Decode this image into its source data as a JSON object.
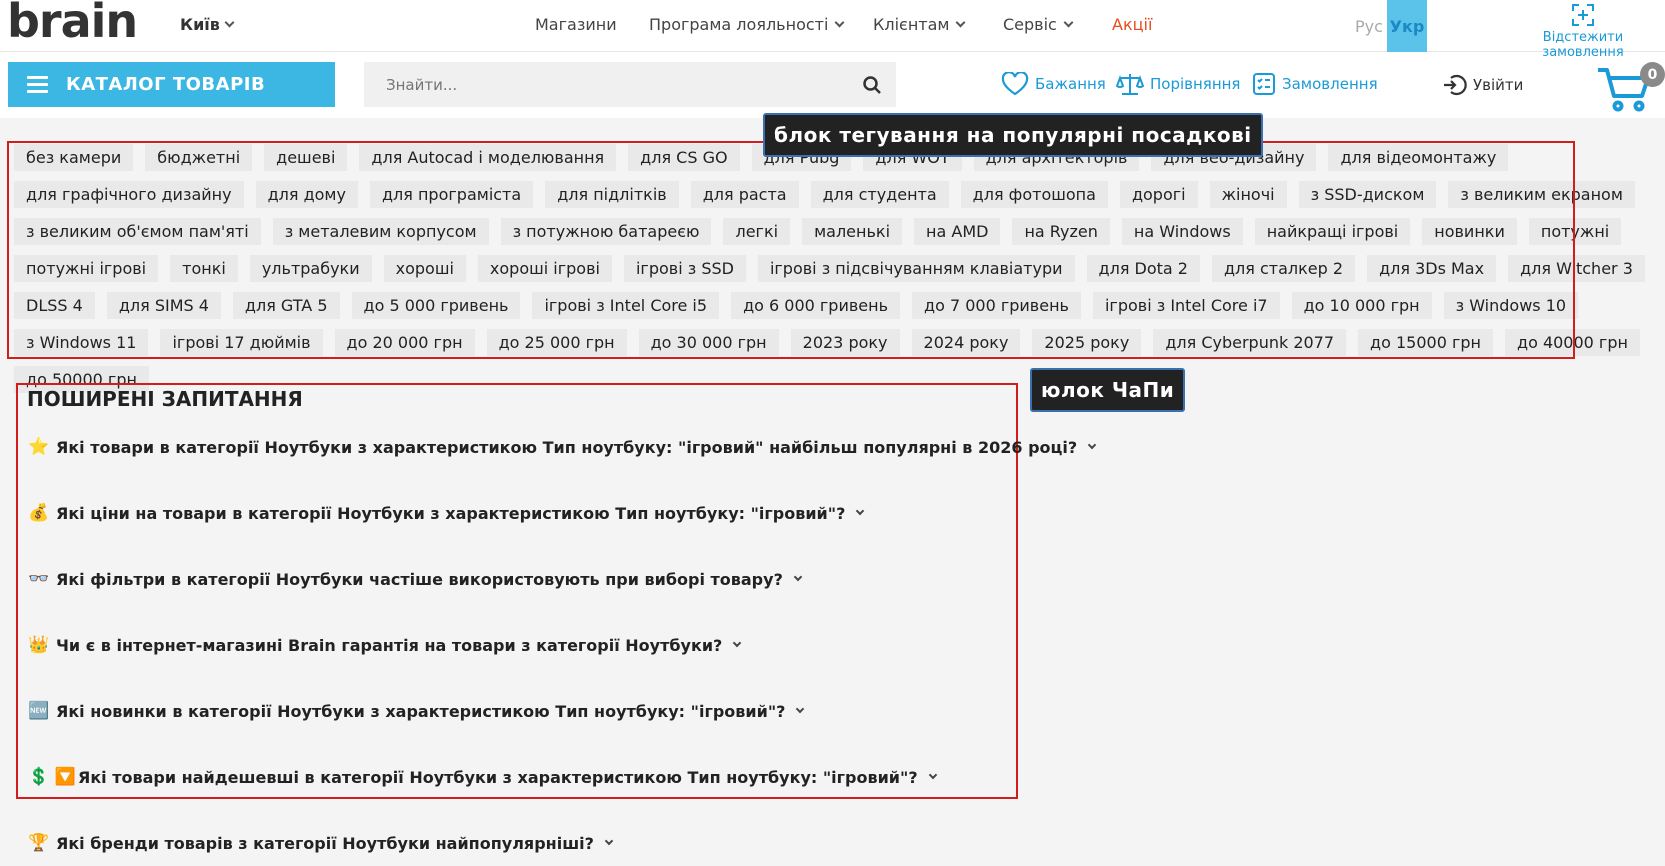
{
  "header": {
    "logo": "brain",
    "city": "Київ",
    "nav": [
      {
        "label": "Магазини",
        "dropdown": false
      },
      {
        "label": "Програма лояльності",
        "dropdown": true
      },
      {
        "label": "Клієнтам",
        "dropdown": true
      },
      {
        "label": "Сервіс",
        "dropdown": true
      },
      {
        "label": "Акції",
        "dropdown": false
      }
    ],
    "lang": {
      "ru": "Рус",
      "uk": "Укр",
      "active": "uk"
    },
    "track_order": "Відстежити замовлення"
  },
  "toolbar": {
    "catalog_label": "КАТАЛОГ ТОВАРІВ",
    "search_placeholder": "Знайти...",
    "wishlist": "Бажання",
    "compare": "Порівняння",
    "orders": "Замовлення",
    "login": "Увійти",
    "cart_count": "0"
  },
  "tags": [
    "без камери",
    "бюджетні",
    "дешеві",
    "для Autocad і моделювання",
    "для CS GO",
    "для Pubg",
    "для WOT",
    "для архітекторів",
    "для веб-дизайну",
    "для відеомонтажу",
    "для графічного дизайну",
    "для дому",
    "для програміста",
    "для підлітків",
    "для раста",
    "для студента",
    "для фотошопа",
    "дорогі",
    "жіночі",
    "з SSD-диском",
    "з великим екраном",
    "з великим об'ємом пам'яті",
    "з металевим корпусом",
    "з потужною батареєю",
    "легкі",
    "маленькі",
    "на AMD",
    "на Ryzen",
    "на Windows",
    "найкращі ігрові",
    "новинки",
    "потужні",
    "потужні ігрові",
    "тонкі",
    "ультрабуки",
    "хороші",
    "хороші ігрові",
    "ігрові з SSD",
    "ігрові з підсвічуванням клавіатури",
    "для Dota 2",
    "для сталкер 2",
    "для 3Ds Max",
    "для Witcher 3",
    "DLSS 4",
    "для SIMS 4",
    "для GTA 5",
    "до 5 000 гривень",
    "ігрові з Intel Core i5",
    "до 6 000 гривень",
    "до 7 000 гривень",
    "ігрові з Intel Core i7",
    "до 10 000 грн",
    "з Windows 10",
    "з Windows 11",
    "ігрові 17 дюймів",
    "до 20 000 грн",
    "до 25 000 грн",
    "до 30 000 грн",
    "2023 року",
    "2024 року",
    "2025 року",
    "для Cyberpunk 2077",
    "до 15000 грн",
    "до 40000 грн",
    "до 50000 грн"
  ],
  "annotations": {
    "tags_callout": "блок тегування на популярні посадкові",
    "faq_callout": "юлок ЧаПи"
  },
  "faq": {
    "title": "ПОШИРЕНІ ЗАПИТАННЯ",
    "items": [
      {
        "emoji": "⭐",
        "text": "Які товари в категорії Ноутбуки з характеристикою Тип ноутбуку: \"ігровий\" найбільш популярні в 2026 році?"
      },
      {
        "emoji": "💰",
        "text": "Які ціни на товари в категорії Ноутбуки з характеристикою Тип ноутбуку: \"ігровий\"?"
      },
      {
        "emoji": "👓",
        "text": "Які фільтри в категорії Ноутбуки частіше використовують при виборі товару?"
      },
      {
        "emoji": "👑",
        "text": "Чи є в інтернет-магазині Brain гарантія на товари з категорії Ноутбуки?"
      },
      {
        "emoji": "🆕",
        "text": "Які новинки в категорії Ноутбуки з характеристикою Тип ноутбуку: \"ігровий\"?"
      },
      {
        "emoji": "💲 🔽",
        "text": "Які товари найдешевші в категорії Ноутбуки з характеристикою Тип ноутбуку: \"ігровий\"?"
      },
      {
        "emoji": "🏆",
        "text": "Які бренди товарів з категорії Ноутбуки найпопулярніші?"
      }
    ]
  },
  "colors": {
    "accent": "#3cb6e3",
    "link": "#1a9ad6",
    "sale": "#e74c1c",
    "annotation_box": "#d21d1d"
  }
}
